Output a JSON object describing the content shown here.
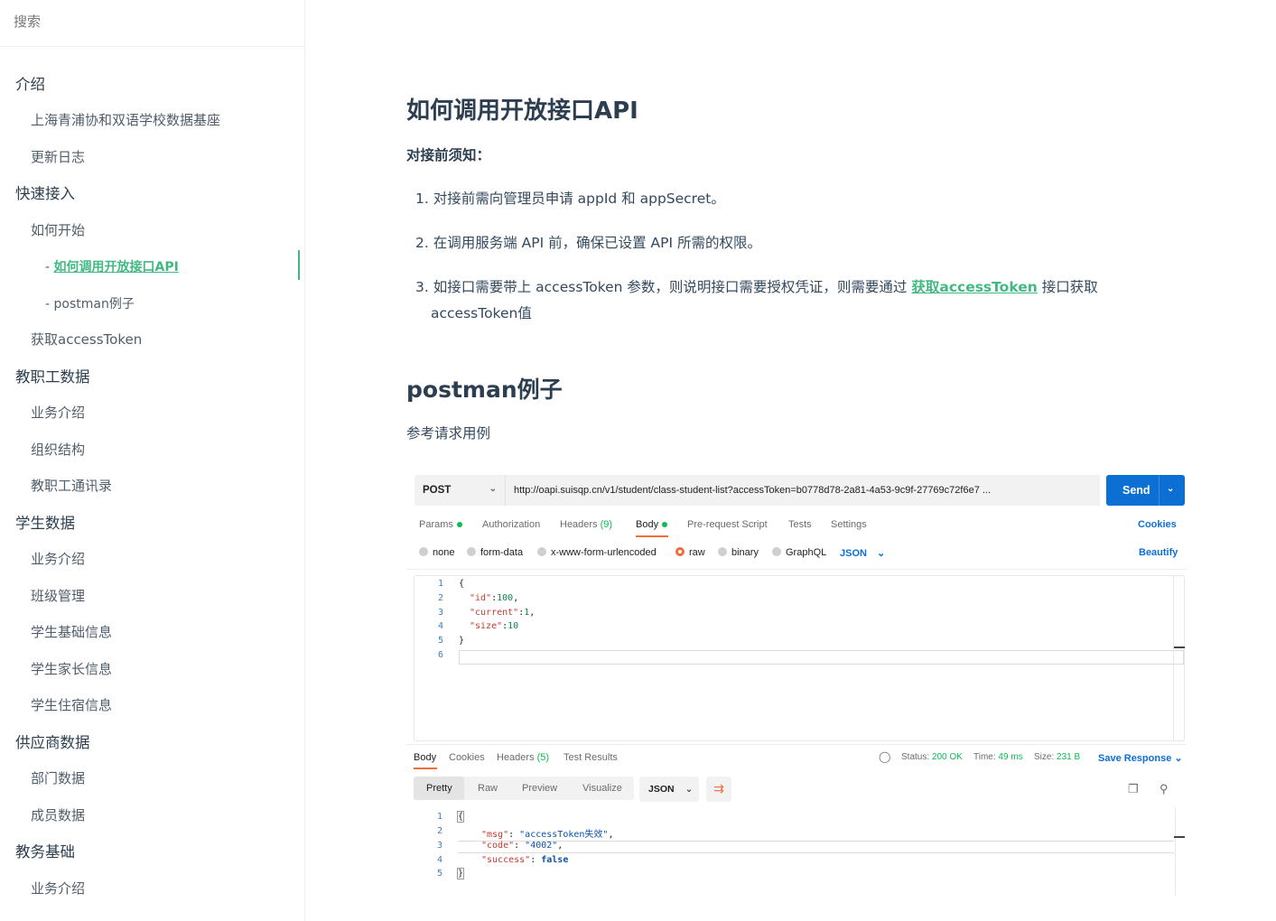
{
  "sidebar": {
    "search_placeholder": "搜索",
    "items": [
      {
        "label": "介绍",
        "level": 1
      },
      {
        "label": "上海青浦协和双语学校数据基座",
        "level": 2
      },
      {
        "label": "更新日志",
        "level": 2
      },
      {
        "label": "快速接入",
        "level": 1
      },
      {
        "label": "如何开始",
        "level": 2
      },
      {
        "label": "如何调用开放接口API",
        "level": 3,
        "active": true
      },
      {
        "label": "postman例子",
        "level": 3
      },
      {
        "label": "获取accessToken",
        "level": 2
      },
      {
        "label": "教职工数据",
        "level": 1
      },
      {
        "label": "业务介绍",
        "level": 2
      },
      {
        "label": "组织结构",
        "level": 2
      },
      {
        "label": "教职工通讯录",
        "level": 2
      },
      {
        "label": "学生数据",
        "level": 1
      },
      {
        "label": "业务介绍",
        "level": 2
      },
      {
        "label": "班级管理",
        "level": 2
      },
      {
        "label": "学生基础信息",
        "level": 2
      },
      {
        "label": "学生家长信息",
        "level": 2
      },
      {
        "label": "学生住宿信息",
        "level": 2
      },
      {
        "label": "供应商数据",
        "level": 1
      },
      {
        "label": "部门数据",
        "level": 2
      },
      {
        "label": "成员数据",
        "level": 2
      },
      {
        "label": "教务基础",
        "level": 1
      },
      {
        "label": "业务介绍",
        "level": 2
      }
    ],
    "sub_prefix": "- "
  },
  "content": {
    "title": "如何调用开放接口API",
    "notice": "对接前须知：",
    "list": [
      {
        "num": "1.",
        "text": "对接前需向管理员申请 appId 和 appSecret。"
      },
      {
        "num": "2.",
        "text": "在调用服务端 API 前，确保已设置 API 所需的权限。"
      },
      {
        "num": "3.",
        "text_before": "如接口需要带上 accessToken 参数，则说明接口需要授权凭证，则需要通过 ",
        "link": "获取accessToken",
        "text_after": " 接口获取",
        "text_line2": "accessToken值"
      }
    ],
    "postman_title": "postman例子",
    "postman_desc": "参考请求用例"
  },
  "postman": {
    "method": "POST",
    "url": "http://oapi.suisqp.cn/v1/student/class-student-list?accessToken=b0778d78-2a81-4a53-9c9f-27769c72f6e7 ...",
    "send": "Send",
    "req_tabs": {
      "params": "Params",
      "authorization": "Authorization",
      "headers": "Headers",
      "headers_count": "(9)",
      "body": "Body",
      "prerequest": "Pre-request Script",
      "tests": "Tests",
      "settings": "Settings"
    },
    "cookies_link": "Cookies",
    "beautify_link": "Beautify",
    "body_types": {
      "none": "none",
      "form_data": "form-data",
      "urlencoded": "x-www-form-urlencoded",
      "raw": "raw",
      "binary": "binary",
      "graphql": "GraphQL"
    },
    "body_format": "JSON",
    "request_body": {
      "line_numbers": [
        "1",
        "2",
        "3",
        "4",
        "5",
        "6"
      ],
      "open": "{",
      "close": "}",
      "fields": [
        {
          "key": "\"id\"",
          "sep": ":",
          "value": "100",
          "trail": ","
        },
        {
          "key": "\"current\"",
          "sep": ":",
          "value": "1",
          "trail": ","
        },
        {
          "key": "\"size\"",
          "sep": ":",
          "value": "10",
          "trail": ""
        }
      ]
    },
    "resp_tabs": {
      "body": "Body",
      "cookies": "Cookies",
      "headers": "Headers",
      "headers_count": "(5)",
      "test_results": "Test Results"
    },
    "status": {
      "status_label": "Status:",
      "status_value": "200 OK",
      "time_label": "Time:",
      "time_value": "49 ms",
      "size_label": "Size:",
      "size_value": "231 B"
    },
    "save_response": "Save Response",
    "view_modes": {
      "pretty": "Pretty",
      "raw": "Raw",
      "preview": "Preview",
      "visualize": "Visualize"
    },
    "resp_format": "JSON",
    "response_body": {
      "line_numbers": [
        "1",
        "2",
        "3",
        "4",
        "5"
      ],
      "open": "{",
      "close": "}",
      "fields": [
        {
          "key": "\"msg\"",
          "sep": ": ",
          "value": "\"accessToken失效\"",
          "trail": ","
        },
        {
          "key": "\"code\"",
          "sep": ": ",
          "value": "\"4002\"",
          "trail": ","
        },
        {
          "key": "\"success\"",
          "sep": ": ",
          "value": "false",
          "trail": ""
        }
      ]
    },
    "colors": {
      "accent": "#42b983",
      "send_blue": "#0b6fd4",
      "active_orange": "#f26b3a",
      "ok_green": "#0cbb52"
    }
  }
}
